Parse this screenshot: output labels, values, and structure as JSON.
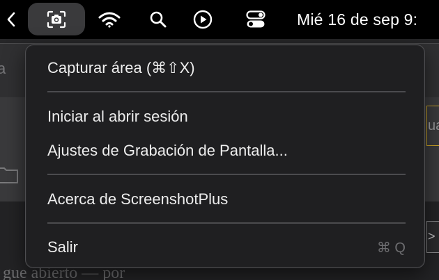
{
  "menubar": {
    "back_glyph": "<",
    "icons": {
      "back": "chevron-left-icon",
      "app": "screenshot-icon",
      "wifi": "wifi-icon",
      "search": "search-icon",
      "play": "play-icon",
      "control_center": "control-center-icon"
    },
    "clock": "Mié 16 de sep  9:"
  },
  "menu": {
    "items": [
      {
        "label": "Capturar área (⌘⇧X)",
        "shortcut": ""
      },
      {
        "label": "Iniciar al abrir sesión",
        "shortcut": ""
      },
      {
        "label": "Ajustes de Grabación de Pantalla...",
        "shortcut": ""
      },
      {
        "label": "Acerca de ScreenshotPlus",
        "shortcut": ""
      },
      {
        "label": "Salir",
        "shortcut": "⌘ Q"
      }
    ]
  },
  "background": {
    "left_fragment": "a",
    "right_fragment_top": "ua",
    "right_fragment_bottom": ">",
    "bottom_fragment": "gue abierto — por"
  },
  "colors": {
    "menubar": "#000000",
    "menu_bg": "#1f1f21",
    "menu_text": "#ededed",
    "shortcut_text": "#6d6d70",
    "highlight_border": "#c9a227"
  }
}
